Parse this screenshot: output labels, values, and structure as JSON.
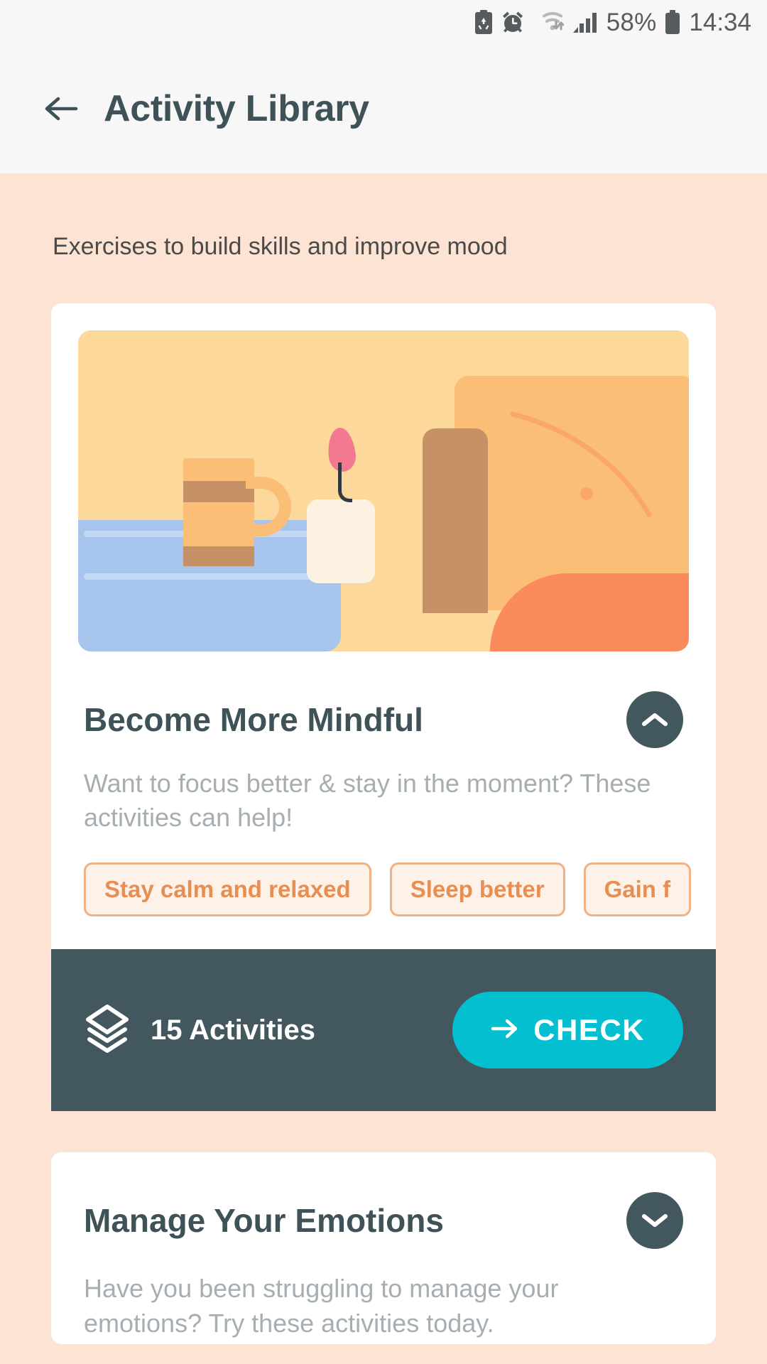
{
  "statusbar": {
    "icons": [
      "battery-saver-icon",
      "alarm-clock-icon",
      "wifi-icon",
      "cellular-signal-icon",
      "battery-icon"
    ],
    "battery_percent": "58%",
    "time": "14:34"
  },
  "appbar": {
    "back_icon": "arrow-left-icon",
    "title": "Activity Library"
  },
  "page": {
    "subtitle": "Exercises to build skills and improve mood"
  },
  "cards": [
    {
      "title": "Become More Mindful",
      "description": "Want to focus better & stay in the moment? These activities can help!",
      "toggle_icon": "chevron-up-icon",
      "expanded": true,
      "tags": [
        "Stay calm and relaxed",
        "Sleep better",
        "Gain f"
      ],
      "footer": {
        "layers_icon": "layers-icon",
        "count_label": "15 Activities",
        "action_icon": "arrow-right-icon",
        "action_label": "CHECK"
      }
    },
    {
      "title": "Manage Your Emotions",
      "description": "Have you been struggling to manage your emotions? Try these activities today.",
      "toggle_icon": "chevron-down-icon",
      "expanded": false
    }
  ],
  "colors": {
    "background": "#FCE3D3",
    "appbar": "#F7F7F7",
    "dark": "#43575E",
    "accent_cyan": "#03BFCF",
    "tag_orange": "#E78F53",
    "muted_text": "#A6AEB2"
  }
}
